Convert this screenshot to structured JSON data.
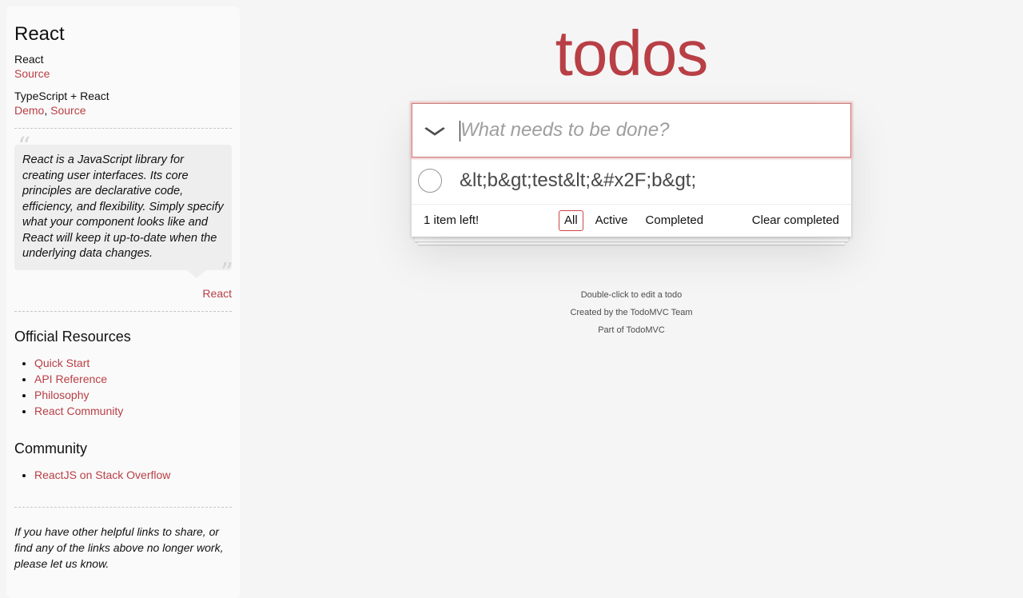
{
  "sidebar": {
    "title": "React",
    "implementations": [
      {
        "name": "React",
        "links": [
          "Source"
        ]
      },
      {
        "name": "TypeScript + React",
        "links": [
          "Demo",
          "Source"
        ],
        "separator": ", "
      }
    ],
    "quote": {
      "open_mark": "“",
      "text": "React is a JavaScript library for creating user interfaces. Its core principles are declarative code, efficiency, and flexibility. Simply specify what your component looks like and React will keep it up-to-date when the underlying data changes.",
      "close_mark": "”",
      "source": "React"
    },
    "official_resources": {
      "title": "Official Resources",
      "items": [
        "Quick Start",
        "API Reference",
        "Philosophy",
        "React Community"
      ]
    },
    "community": {
      "title": "Community",
      "items": [
        "ReactJS on Stack Overflow"
      ]
    },
    "footer_note": "If you have other helpful links to share, or find any of the links above no longer work, please let us know."
  },
  "app": {
    "title": "todos",
    "toggle_all_icon": "chevron-down-icon",
    "toggle_all_glyph": "❯",
    "new_todo_placeholder": "What needs to be done?",
    "new_todo_value": "",
    "todos": [
      {
        "title": "&lt;b&gt;test&lt;&#x2F;b&gt;",
        "completed": false
      }
    ],
    "footer": {
      "count_text": "1 item left!",
      "filters": [
        "All",
        "Active",
        "Completed"
      ],
      "selected_filter": "All",
      "clear_completed": "Clear completed"
    }
  },
  "info": {
    "lines": [
      "Double-click to edit a todo",
      "Created by the TodoMVC Team",
      "Part of TodoMVC"
    ]
  },
  "colors": {
    "accent": "#b83f45",
    "background": "#f5f5f5",
    "selected_filter_border": "#ce4646"
  }
}
